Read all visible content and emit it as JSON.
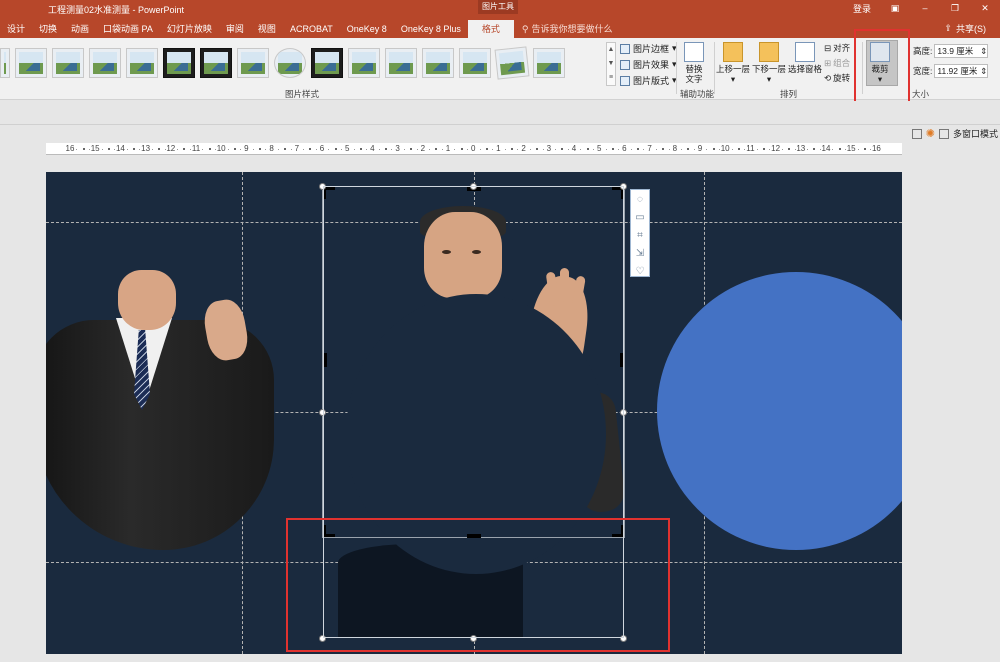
{
  "window": {
    "title": "工程测量02水准测量  -  PowerPoint",
    "context_tab_label": "图片工具",
    "login": "登录",
    "share": "共享(S)"
  },
  "tabs": [
    {
      "label": "设计"
    },
    {
      "label": "切换"
    },
    {
      "label": "动画"
    },
    {
      "label": "口袋动画 PA"
    },
    {
      "label": "幻灯片放映"
    },
    {
      "label": "审阅"
    },
    {
      "label": "视图"
    },
    {
      "label": "ACROBAT"
    },
    {
      "label": "OneKey 8"
    },
    {
      "label": "OneKey 8 Plus"
    },
    {
      "label": "格式"
    }
  ],
  "tell_me": {
    "placeholder": "告诉我你想要做什么"
  },
  "ribbon": {
    "picture_styles_group": "图片样式",
    "picture_border": "图片边框",
    "picture_effects": "图片效果",
    "picture_layout": "图片版式",
    "accessibility_group": "辅助功能",
    "alt_text_line1": "替换",
    "alt_text_line2": "文字",
    "arrange_group": "排列",
    "bring_forward": "上移一层",
    "send_backward": "下移一层",
    "selection_pane": "选择窗格",
    "align": "对齐",
    "group": "组合",
    "rotate": "旋转",
    "crop": "裁剪",
    "size_group": "大小",
    "height_label": "高度:",
    "height_value": "13.9 厘米",
    "width_label": "宽度:",
    "width_value": "11.92 厘米"
  },
  "view": {
    "multi_window": "多窗口模式"
  },
  "ruler": {
    "labels": [
      "16",
      "15",
      "14",
      "13",
      "12",
      "11",
      "10",
      "9",
      "8",
      "7",
      "6",
      "5",
      "4",
      "3",
      "2",
      "1",
      "0",
      "1",
      "2",
      "3",
      "4",
      "5",
      "6",
      "7",
      "8",
      "9",
      "10",
      "11",
      "12",
      "13",
      "14",
      "15",
      "16"
    ]
  },
  "colors": {
    "accent": "#b7472a",
    "slide_bg": "#1a2a3e",
    "circle": "#4472c4",
    "highlight_box": "#e0322f"
  },
  "icons": [
    "search-icon",
    "share-icon",
    "crop-icon",
    "alt-text-icon",
    "layout-options-icon",
    "heart-icon"
  ]
}
